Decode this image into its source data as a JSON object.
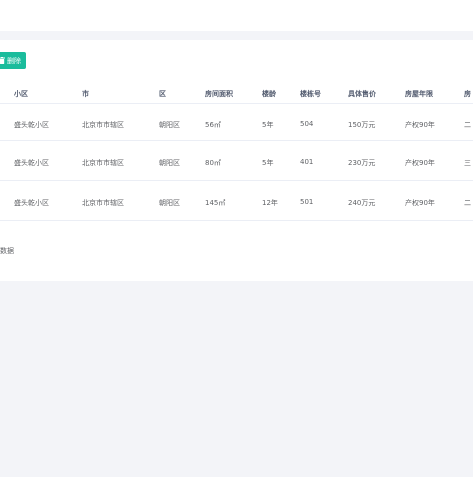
{
  "toolbar": {
    "delete_label": "删除"
  },
  "table": {
    "columns": [
      "小区",
      "市",
      "区",
      "房间面积",
      "楼龄",
      "楼栋号",
      "具体售价",
      "房屋年限",
      "房"
    ],
    "rows": [
      [
        "盛头乾小区",
        "北京市市辖区",
        "朝阳区",
        "56㎡",
        "5年",
        "504",
        "150万元",
        "产权90年",
        "二"
      ],
      [
        "盛头乾小区",
        "北京市市辖区",
        "朝阳区",
        "80㎡",
        "5年",
        "401",
        "230万元",
        "产权90年",
        "三"
      ],
      [
        "盛头乾小区",
        "北京市市辖区",
        "朝阳区",
        "145㎡",
        "12年",
        "501",
        "240万元",
        "产权90年",
        "二"
      ]
    ]
  },
  "pagination": {
    "total_text": "数据"
  },
  "colors": {
    "accent": "#1abc9c",
    "page_bg": "#f3f4f8",
    "panel_bg": "#ffffff"
  }
}
